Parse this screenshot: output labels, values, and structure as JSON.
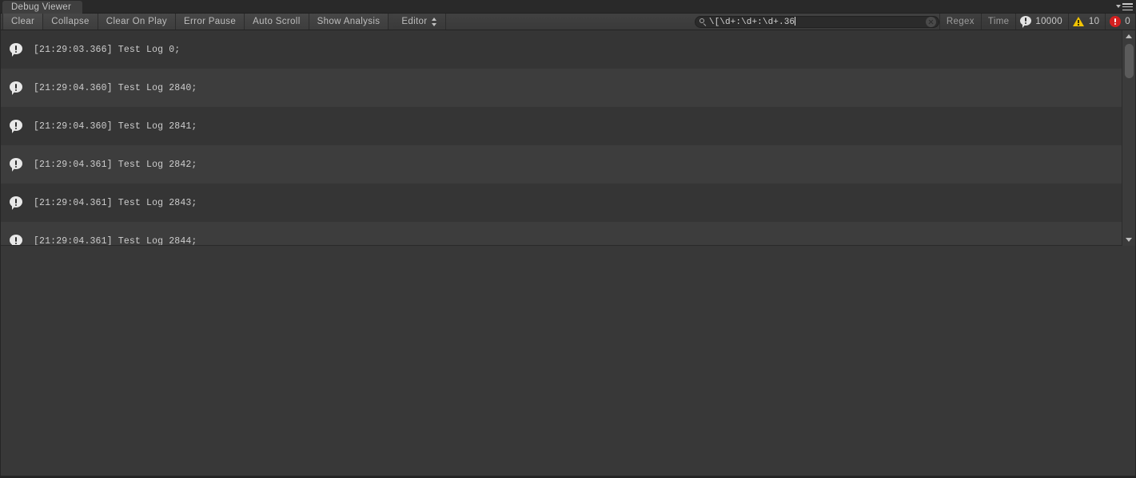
{
  "window": {
    "tab_label": "Debug Viewer",
    "panel_menu_icon": "hamburger-menu-icon"
  },
  "toolbar": {
    "clear_label": "Clear",
    "collapse_label": "Collapse",
    "clear_on_play_label": "Clear On Play",
    "error_pause_label": "Error Pause",
    "auto_scroll_label": "Auto Scroll",
    "show_analysis_label": "Show Analysis",
    "editor_dropdown_label": "Editor",
    "regex_label": "Regex",
    "time_label": "Time"
  },
  "search": {
    "value": "\\[\\d+:\\d+:\\d+.36",
    "placeholder": "Search",
    "search_icon": "magnifier-icon",
    "clear_icon": "clear-circle-x-icon"
  },
  "counters": {
    "info": {
      "icon": "info-bubble-icon",
      "count": "10000",
      "color": "#e3e3e3"
    },
    "warning": {
      "icon": "warning-triangle-icon",
      "count": "10",
      "color": "#f2c404"
    },
    "error": {
      "icon": "error-circle-icon",
      "count": "0",
      "color": "#d42020"
    }
  },
  "log_list": {
    "row_icon": "info-bubble-icon",
    "rows": [
      {
        "text": "[21:29:03.366] Test Log 0;"
      },
      {
        "text": "[21:29:04.360] Test Log 2840;"
      },
      {
        "text": "[21:29:04.360] Test Log 2841;"
      },
      {
        "text": "[21:29:04.361] Test Log 2842;"
      },
      {
        "text": "[21:29:04.361] Test Log 2843;"
      },
      {
        "text": "[21:29:04.361] Test Log 2844;"
      }
    ]
  },
  "scrollbar": {
    "up_icon": "arrow-up-icon",
    "down_icon": "arrow-down-icon"
  },
  "detail_pane": {
    "content": ""
  },
  "colors": {
    "background": "#383838",
    "toolbar": "#3f3f3f",
    "row_odd": "#353535",
    "row_even": "#3d3d3d",
    "text": "#cdcdcd"
  }
}
